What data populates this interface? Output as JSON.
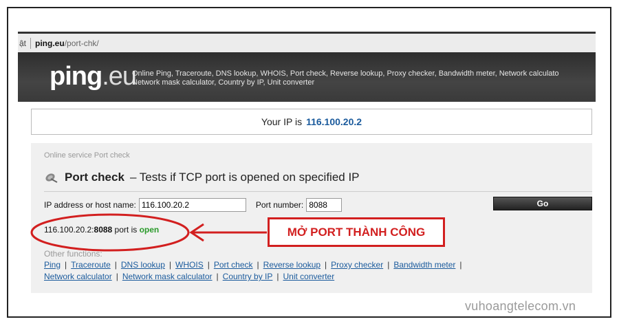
{
  "browser": {
    "tab_fragment": "ật",
    "host": "ping.eu",
    "path": "/port-chk/"
  },
  "header": {
    "logo_bold": "ping",
    "logo_light": ".eu",
    "tagline_line1": "Online Ping, Traceroute, DNS lookup, WHOIS, Port check, Reverse lookup, Proxy checker, Bandwidth meter, Network calculato",
    "tagline_line2": "Network mask calculator, Country by IP, Unit converter"
  },
  "ip_box": {
    "prefix": "Your IP is",
    "ip": "116.100.20.2"
  },
  "panel": {
    "service_label": "Online service Port check",
    "title_bold": "Port check",
    "title_rest": "– Tests if TCP port is opened on specified IP",
    "host_label": "IP address or host name:",
    "host_value": "116.100.20.2",
    "port_label": "Port number:",
    "port_value": "8088",
    "go_label": "Go",
    "result_host": "116.100.20.2:",
    "result_port": "8088",
    "result_mid": " port is ",
    "result_status": "open",
    "other_label": "Other functions:",
    "links": [
      "Ping",
      "Traceroute",
      "DNS lookup",
      "WHOIS",
      "Port check",
      "Reverse lookup",
      "Proxy checker",
      "Bandwidth meter",
      "Network calculator",
      "Network mask calculator",
      "Country by IP",
      "Unit converter"
    ]
  },
  "annotation": {
    "callout_text": "MỞ PORT THÀNH CÔNG",
    "color": "#d21f1f"
  },
  "watermark": "vuhoangtelecom.vn"
}
